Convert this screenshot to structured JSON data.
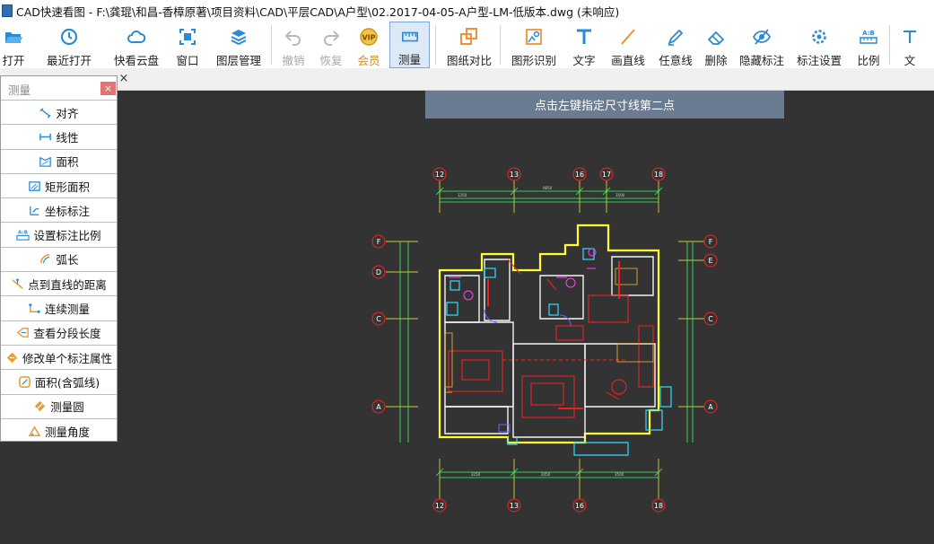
{
  "window": {
    "title": "CAD快速看图 - F:\\龚琨\\和昌-香樟原著\\项目资料\\CAD\\平层CAD\\A户型\\02.2017-04-05-A户型-LM-低版本.dwg (未响应)"
  },
  "toolbar": {
    "items": [
      {
        "label": "打开",
        "icon": "folder-open-icon"
      },
      {
        "label": "最近打开",
        "icon": "clock-history-icon"
      },
      {
        "label": "快看云盘",
        "icon": "cloud-icon"
      },
      {
        "label": "窗口",
        "icon": "window-focus-icon"
      },
      {
        "label": "图层管理",
        "icon": "layers-icon"
      },
      {
        "label": "撤销",
        "icon": "undo-icon"
      },
      {
        "label": "恢复",
        "icon": "redo-icon"
      },
      {
        "label": "会员",
        "icon": "vip-badge-icon"
      },
      {
        "label": "测量",
        "icon": "ruler-icon"
      },
      {
        "label": "图纸对比",
        "icon": "compare-squares-icon"
      },
      {
        "label": "图形识别",
        "icon": "shape-recognition-icon"
      },
      {
        "label": "文字",
        "icon": "text-t-icon"
      },
      {
        "label": "画直线",
        "icon": "line-icon"
      },
      {
        "label": "任意线",
        "icon": "pencil-icon"
      },
      {
        "label": "删除",
        "icon": "eraser-icon"
      },
      {
        "label": "隐藏标注",
        "icon": "eye-slash-icon"
      },
      {
        "label": "标注设置",
        "icon": "settings-gear-icon"
      },
      {
        "label": "比例",
        "icon": "scale-ab-icon"
      },
      {
        "label": "文",
        "icon": "text-icon"
      }
    ]
  },
  "prompt": {
    "text": "点击左键指定尺寸线第二点"
  },
  "panel": {
    "title": "测量",
    "close": "×",
    "items": [
      {
        "label": "对齐",
        "icon": "align-measure-icon"
      },
      {
        "label": "线性",
        "icon": "linear-measure-icon"
      },
      {
        "label": "面积",
        "icon": "area-icon"
      },
      {
        "label": "矩形面积",
        "icon": "rect-area-icon"
      },
      {
        "label": "坐标标注",
        "icon": "coordinate-icon"
      },
      {
        "label": "设置标注比例",
        "icon": "set-scale-icon"
      },
      {
        "label": "弧长",
        "icon": "arc-length-icon"
      },
      {
        "label": "点到直线的距离",
        "icon": "point-line-distance-icon"
      },
      {
        "label": "连续测量",
        "icon": "continuous-measure-icon"
      },
      {
        "label": "查看分段长度",
        "icon": "segment-length-icon"
      },
      {
        "label": "修改单个标注属性",
        "icon": "edit-dimension-icon"
      },
      {
        "label": "面积(含弧线)",
        "icon": "arc-area-icon"
      },
      {
        "label": "测量圆",
        "icon": "circle-measure-icon"
      },
      {
        "label": "测量角度",
        "icon": "angle-icon"
      }
    ]
  },
  "tabs": {
    "close": "×"
  },
  "drawing": {
    "grid_labels_top": [
      "12",
      "13",
      "16",
      "17",
      "18"
    ],
    "grid_labels_bottom": [
      "12",
      "13",
      "16",
      "18"
    ],
    "grid_labels_left": [
      "F",
      "D",
      "C",
      "A"
    ],
    "grid_labels_right": [
      "F",
      "E",
      "C",
      "A"
    ]
  },
  "colors": {
    "canvas": "#333334",
    "accent": "#2aa7e0",
    "prompt_bg": "#6b7b91",
    "cad_red": "#ff2020",
    "cad_yellow": "#ffff33",
    "cad_green": "#66ff33",
    "cad_cyan": "#33ddff"
  }
}
